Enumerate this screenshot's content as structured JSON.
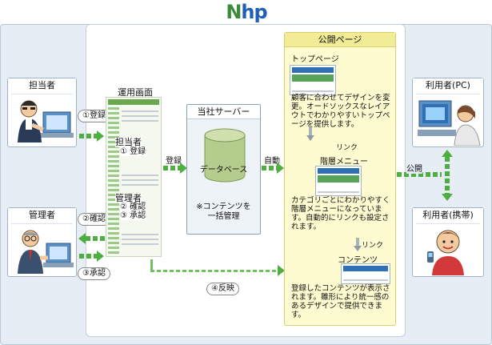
{
  "logo": {
    "n": "N",
    "rest": "hp"
  },
  "actors": {
    "tanto": {
      "title": "担当者"
    },
    "kanri": {
      "title": "管理者"
    },
    "pc": {
      "title": "利用者(PC)"
    },
    "keitai": {
      "title": "利用者(携帯)"
    }
  },
  "steps": {
    "toroku": "①登録",
    "kakunin": "②確認",
    "shonin": "③承認",
    "hanei": "④反映"
  },
  "unyo": {
    "title": "運用画面",
    "tanto_label": "担当者",
    "tanto_step": "① 登録",
    "kanri_label": "管理者",
    "kanri_step1": "② 確認",
    "kanri_step2": "③ 承認"
  },
  "flow": {
    "toroku": "登録",
    "jido": "自動",
    "kokai": "公開"
  },
  "server": {
    "title": "当社サーバー",
    "db": "データベース",
    "note_1": "※コンテンツを",
    "note_2": "一括管理"
  },
  "public": {
    "title": "公開ページ",
    "top_title": "トップページ",
    "top_desc": "顧客に合わせてデザインを変更。オードソックスなレイアウトでわかりやすいトップページを提供します。",
    "link_1": "リンク",
    "menu_title": "階層メニュー",
    "menu_desc": "カテゴリごとにわかりやすく階層メニューになっています。自動的にリンクも設定されます。",
    "link_2": "リンク",
    "contents_title": "コンテンツ",
    "contents_desc": "登録したコンテンツが表示されます。雛形により統一感のあるデザインで提供できます。"
  },
  "colors": {
    "green": "#4caf3f",
    "blue_bg": "#e6edf5",
    "yellow_bg": "#fffbd0"
  }
}
